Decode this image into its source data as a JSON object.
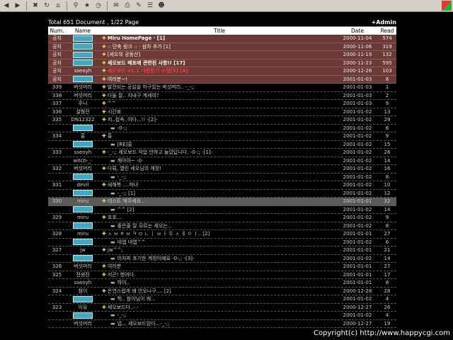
{
  "toolbar": {
    "buttons": [
      "back-icon",
      "forward-icon",
      "stop-icon",
      "refresh-icon",
      "home-icon",
      "search-icon",
      "favorites-icon",
      "history-icon",
      "mail-icon",
      "print-icon",
      "edit-icon",
      "discuss-icon",
      "messenger-icon"
    ]
  },
  "board": {
    "total": "Total 651 Document ,",
    "page": "1/22 Page",
    "admin": "+Admin",
    "headers": {
      "num": "Num.",
      "name": "Name",
      "title": "Title",
      "date": "Date",
      "read": "Read"
    }
  },
  "rows": [
    {
      "num": "공지",
      "name": "",
      "badge": true,
      "title": "Miru HomePage · [1]",
      "date": "2000-11-04",
      "read": "574",
      "type": "notice",
      "bold": true
    },
    {
      "num": "공지",
      "name": "",
      "badge": true,
      "title": ":: 단축 링크 :: - 삼차 추가 [1]",
      "date": "2000-11-06",
      "read": "319",
      "type": "notice"
    },
    {
      "num": "공지",
      "name": "",
      "badge": true,
      "title": "[세오의 공동산]",
      "date": "2000-11-19",
      "read": "132",
      "type": "notice"
    },
    {
      "num": "공지",
      "name": "",
      "badge": true,
      "title": "세오보드 배포에 관련된 사항!! [17]",
      "date": "2000-11-23",
      "read": "595",
      "type": "notice",
      "bold": true
    },
    {
      "num": "공지",
      "name": "sseoyh",
      "badge": false,
      "title": "세오보드 v1.1 다운받기 수정[5] [4]",
      "date": "2000-12-26",
      "read": "103",
      "type": "notice",
      "red": true
    },
    {
      "num": "공지",
      "name": "",
      "badge": true,
      "title": "여러분~!",
      "date": "2001-01-03",
      "read": "8",
      "type": "notice"
    },
    {
      "num": "339",
      "name": "버섯머리",
      "badge": false,
      "title": "발전되는 공살을 하구있는 버섯머리.. -_-;;",
      "date": "2001-01-03",
      "read": "1",
      "type": "row"
    },
    {
      "num": "338",
      "name": "버섯머리",
      "badge": false,
      "title": "다들 잘.. 지내구 계세여?",
      "date": "2001-01-03",
      "read": "2",
      "type": "row"
    },
    {
      "num": "337",
      "name": "주니",
      "badge": false,
      "title": "^^",
      "date": "2001-01-03",
      "read": "9",
      "type": "row"
    },
    {
      "num": "336",
      "name": "설형진",
      "badge": false,
      "title": "시간표",
      "date": "2001-01-02",
      "read": "13",
      "type": "row"
    },
    {
      "num": "335",
      "name": "DN12322",
      "badge": false,
      "title": "저..접속..이다...!! -[2]-",
      "date": "2001-01-02",
      "read": "29",
      "type": "row"
    },
    {
      "num": "",
      "name": "",
      "badge": true,
      "title": "-0-;;",
      "date": "2001-01-02",
      "read": "6",
      "type": "reply"
    },
    {
      "num": "334",
      "name": "홍",
      "badge": false,
      "title": "홍",
      "date": "2001-01-02",
      "read": "9",
      "type": "row"
    },
    {
      "num": "",
      "name": "",
      "badge": true,
      "title": "[RE]홍",
      "date": "2001-01-02",
      "read": "15",
      "type": "reply"
    },
    {
      "num": "333",
      "name": "sseoyh",
      "badge": false,
      "title": "-_-;; 세오보드 작업 안하고 놀았답니다. -0-;; -[1]-",
      "date": "2001-01-02",
      "read": "26",
      "type": "row"
    },
    {
      "num": "",
      "name": "witch-_-",
      "badge": false,
      "title": "깨아아~ -0-",
      "date": "2001-01-02",
      "read": "14",
      "type": "reply"
    },
    {
      "num": "332",
      "name": "버섯머리",
      "badge": false,
      "title": "다뤄, 열린 세오님의 게정!",
      "date": "2001-01-02",
      "read": "16",
      "type": "row"
    },
    {
      "num": "",
      "name": "",
      "badge": true,
      "title": "-_-;;",
      "date": "2001-01-02",
      "read": "8",
      "type": "reply"
    },
    {
      "num": "331",
      "name": "devil",
      "badge": false,
      "title": "새해복 ....마녀",
      "date": "2001-01-02",
      "read": "10",
      "type": "row"
    },
    {
      "num": "",
      "name": "",
      "badge": true,
      "title": "-_-;; [1]",
      "date": "2001-01-02",
      "read": "12",
      "type": "reply"
    },
    {
      "num": "330",
      "name": "miru",
      "badge": false,
      "title": "테스트 해주세요...",
      "date": "2001-01-01",
      "read": "32",
      "type": "hl"
    },
    {
      "num": "",
      "name": "",
      "badge": true,
      "title": "^^ [2]",
      "date": "2001-01-02",
      "read": "14",
      "type": "reply"
    },
    {
      "num": "329",
      "name": "miru",
      "badge": false,
      "title": "호호...",
      "date": "2001-01-02",
      "read": "9",
      "type": "row"
    },
    {
      "num": "",
      "name": "",
      "badge": true,
      "title": "좋은줄 잘 모르는 세오는...",
      "date": "2001-01-02",
      "read": "8",
      "type": "reply"
    },
    {
      "num": "328",
      "name": "miru",
      "badge": false,
      "title": "ㅅ ㅂ ㅎ ㅂ ㅋ ㅁ ㄴ ㅣ ㅂ ㅏ 두 ㅅ ㅔ ㅇ ㅣ.. [2]",
      "date": "2001-01-01",
      "read": "27",
      "type": "row"
    },
    {
      "num": "",
      "name": "",
      "badge": true,
      "title": "네엡 네엡^^",
      "date": "2001-01-02",
      "read": "6",
      "type": "reply"
    },
    {
      "num": "327",
      "name": "jw",
      "badge": false,
      "title": "jw^^;",
      "date": "2001-01-01",
      "read": "21",
      "type": "row"
    },
    {
      "num": "",
      "name": "",
      "badge": true,
      "title": "어차피 포기한 계정이예요 -0-;; -[3]-",
      "date": "2001-01-02",
      "read": "14",
      "type": "reply"
    },
    {
      "num": "326",
      "name": "버섯머리",
      "badge": false,
      "title": "여러분",
      "date": "2001-01-01",
      "read": "27",
      "type": "row"
    },
    {
      "num": "325",
      "name": "전생진",
      "badge": false,
      "title": "서곤! 했어다.",
      "date": "2001-01-01",
      "read": "17",
      "type": "row"
    },
    {
      "num": "",
      "name": "sseoyh",
      "badge": false,
      "title": "하이..",
      "date": "2001-01-01",
      "read": "8",
      "type": "reply"
    },
    {
      "num": "324",
      "name": "참이",
      "badge": false,
      "title": "은연스럽게 왜 안오나구.... [2]",
      "date": "2000-12-28",
      "read": "28",
      "type": "row"
    },
    {
      "num": "",
      "name": "",
      "badge": true,
      "title": "헉.. 참이님이 왜...",
      "date": "2001-01-02",
      "read": "4",
      "type": "reply"
    },
    {
      "num": "323",
      "name": "이유",
      "badge": false,
      "title": "세오보드다..-.-",
      "date": "2000-12-27",
      "read": "26",
      "type": "row"
    },
    {
      "num": "",
      "name": "",
      "badge": true,
      "title": "-_-;;",
      "date": "2001-01-02",
      "read": "4",
      "type": "reply"
    },
    {
      "num": "",
      "name": "버섯머리",
      "badge": false,
      "title": "넵... 세오보드임다...-_-;;",
      "date": "2000-12-27",
      "read": "19",
      "type": "reply"
    }
  ],
  "footer": "Copyright(c) http://www.happycgi.com"
}
